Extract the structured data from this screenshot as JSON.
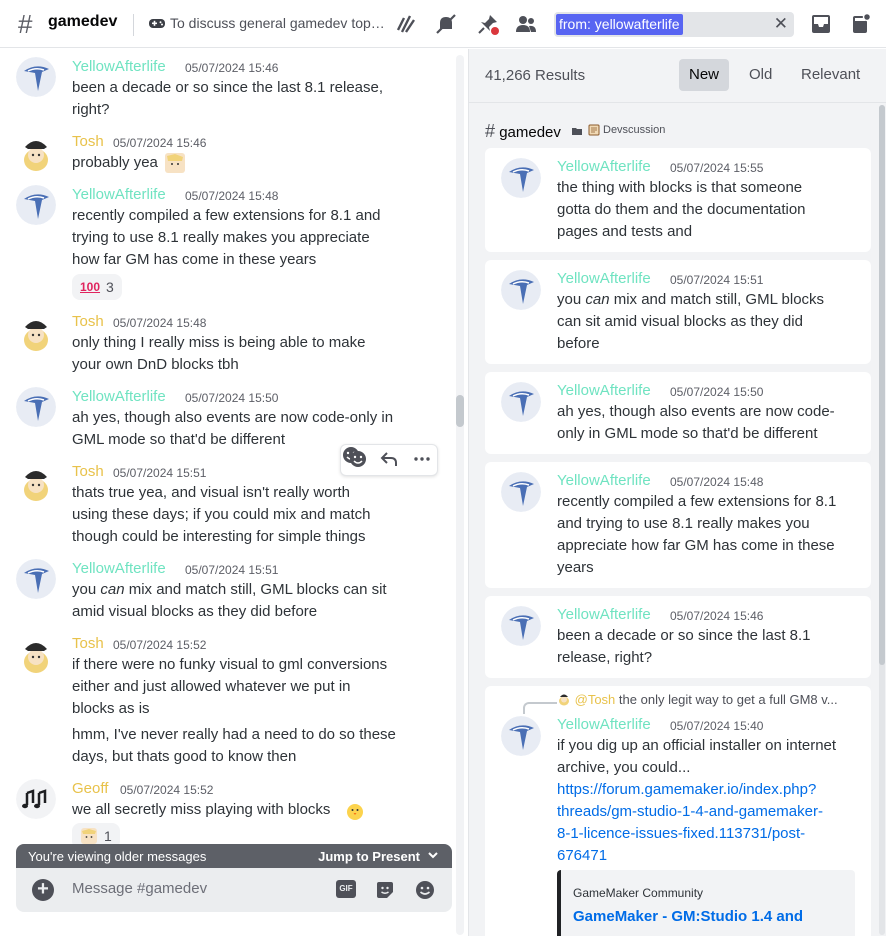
{
  "header": {
    "channel_name": "gamedev",
    "topic": "To discuss general gamedev topics...",
    "search_token": "from: yellowafterlife"
  },
  "chat": {
    "messages": [
      {
        "author": "YellowAfterlife",
        "time": "05/07/2024 15:46",
        "lines": [
          "been a decade or so since the last 8.1 release,",
          "right?"
        ]
      },
      {
        "author": "Tosh",
        "time": "05/07/2024 15:46",
        "lines": [
          "probably yea"
        ]
      },
      {
        "author": "YellowAfterlife",
        "time": "05/07/2024 15:48",
        "lines": [
          "recently compiled a few extensions for 8.1 and",
          "trying to use 8.1 really makes you appreciate",
          "how far GM has come in these years"
        ],
        "reaction": {
          "emoji": "100",
          "count": "3"
        }
      },
      {
        "author": "Tosh",
        "time": "05/07/2024 15:48",
        "lines": [
          "only thing I really miss is being able to make",
          "your own DnD blocks tbh"
        ]
      },
      {
        "author": "YellowAfterlife",
        "time": "05/07/2024 15:50",
        "lines": [
          "ah yes, though also events are now code-only in",
          "GML mode so that'd be different"
        ]
      },
      {
        "author": "Tosh",
        "time": "05/07/2024 15:51",
        "lines": [
          "thats true yea, and visual isn't really worth",
          "using these days; if you could mix and match",
          "though could be interesting for simple things"
        ]
      },
      {
        "author": "YellowAfterlife",
        "time": "05/07/2024 15:51",
        "lines": [
          "you",
          "can",
          "mix and match still, GML blocks can sit",
          "amid visual blocks as they did before"
        ]
      },
      {
        "author": "Tosh",
        "time": "05/07/2024 15:52",
        "lines": [
          "if there were no funky visual to gml conversions",
          "either and just allowed whatever we put in",
          "blocks as is",
          "hmm, I've never really had a need to do so these",
          "days, but thats good to know then"
        ]
      },
      {
        "author": "Geoff",
        "time": "05/07/2024 15:52",
        "lines": [
          "we all secretly miss playing with blocks"
        ],
        "reaction": {
          "count": "1"
        }
      }
    ],
    "older_notice": "You're viewing older messages",
    "jump_label": "Jump to Present",
    "composer_placeholder": "Message #gamedev",
    "gif_label": "GIF"
  },
  "search": {
    "result_count": "41,266 Results",
    "sort_options": [
      "New",
      "Old",
      "Relevant"
    ],
    "active_sort": "New",
    "channel": "gamedev",
    "category": "Devscussion",
    "results": [
      {
        "author": "YellowAfterlife",
        "time": "05/07/2024 15:55",
        "lines": [
          "the thing with blocks is that someone",
          "gotta do them and the documentation",
          "pages and tests and"
        ]
      },
      {
        "author": "YellowAfterlife",
        "time": "05/07/2024 15:51",
        "lines": [
          "you",
          "can",
          "mix and match still, GML blocks",
          "can sit amid visual blocks as they did",
          "before"
        ]
      },
      {
        "author": "YellowAfterlife",
        "time": "05/07/2024 15:50",
        "lines": [
          "ah yes, though also events are now code-",
          "only in GML mode so that'd be different"
        ]
      },
      {
        "author": "YellowAfterlife",
        "time": "05/07/2024 15:48",
        "lines": [
          "recently compiled a few extensions for 8.1",
          "and trying to use 8.1 really makes you",
          "appreciate how far GM has come in these",
          "years"
        ]
      },
      {
        "author": "YellowAfterlife",
        "time": "05/07/2024 15:46",
        "lines": [
          "been a decade or so since the last 8.1",
          "release, right?"
        ]
      },
      {
        "author": "YellowAfterlife",
        "time": "05/07/2024 15:40",
        "reply_mention": "@Tosh",
        "reply_text": "the only legit way to get a full GM8 v...",
        "lines": [
          "if you dig up an official installer on internet",
          "archive, you could..."
        ],
        "link_lines": [
          "https://forum.gamemaker.io/index.php?",
          "threads/gm-studio-1-4-and-gamemaker-",
          "8-1-licence-issues-fixed.113731/post-",
          "676471"
        ],
        "embed_provider": "GameMaker Community",
        "embed_title": "GameMaker - GM:Studio 1.4 and"
      }
    ]
  },
  "colors": {
    "accent": "#5865f2",
    "yellowafterlife": "#6fe3c1",
    "tosh": "#e8c24b",
    "link": "#006ce7"
  }
}
